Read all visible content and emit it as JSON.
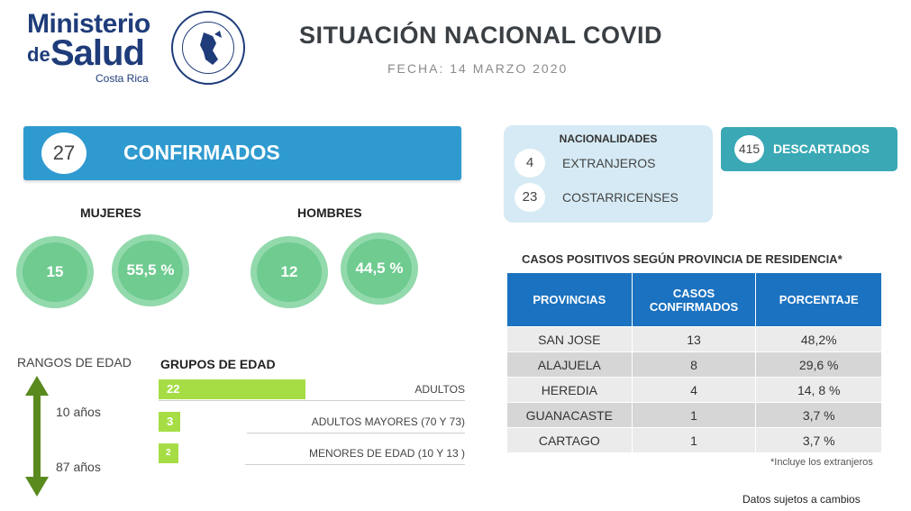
{
  "header": {
    "logo_line1": "Ministerio",
    "logo_de": "de",
    "logo_salud": "Salud",
    "logo_country": "Costa Rica",
    "title": "SITUACIÓN NACIONAL COVID",
    "date": "FECHA: 14 MARZO 2020"
  },
  "confirmados": {
    "count": "27",
    "label": "CONFIRMADOS"
  },
  "mujeres": {
    "label": "MUJERES",
    "count": "15",
    "percent": "55,5 %"
  },
  "hombres": {
    "label": "HOMBRES",
    "count": "12",
    "percent": "44,5 %"
  },
  "nacionalidades": {
    "title": "NACIONALIDADES",
    "items": [
      {
        "count": "4",
        "label": "EXTRANJEROS"
      },
      {
        "count": "23",
        "label": "COSTARRICENSES"
      }
    ]
  },
  "descartados": {
    "count": "415",
    "label": "DESCARTADOS"
  },
  "provincias": {
    "title": "CASOS POSITIVOS SEGÚN PROVINCIA DE RESIDENCIA*",
    "headers": [
      "PROVINCIAS",
      "CASOS CONFIRMADOS",
      "PORCENTAJE"
    ],
    "rows": [
      [
        "SAN JOSE",
        "13",
        "48,2%"
      ],
      [
        "ALAJUELA",
        "8",
        "29,6 %"
      ],
      [
        "HEREDIA",
        "4",
        "14, 8 %"
      ],
      [
        "GUANACASTE",
        "1",
        "3,7 %"
      ],
      [
        "CARTAGO",
        "1",
        "3,7 %"
      ]
    ],
    "footnote": "*Incluye los extranjeros"
  },
  "edad": {
    "rangos_label": "RANGOS DE EDAD",
    "min": "10 años",
    "max": "87 años",
    "grupos_title": "GRUPOS DE EDAD",
    "grupos": [
      {
        "count": "22",
        "label": "ADULTOS"
      },
      {
        "count": "3",
        "label": "ADULTOS MAYORES (70 Y 73)"
      },
      {
        "count": "2",
        "label": "MENORES DE EDAD (10 Y 13 )"
      }
    ]
  },
  "footer": "Datos sujetos a cambios",
  "colors": {
    "confirm_blue": "#2f9ad0",
    "table_header": "#1b72c0",
    "gender_green": "#6fcb90",
    "bar_green": "#a6dd45",
    "descartados_teal": "#3aa8b5",
    "arrow_green": "#5a8a1e"
  }
}
